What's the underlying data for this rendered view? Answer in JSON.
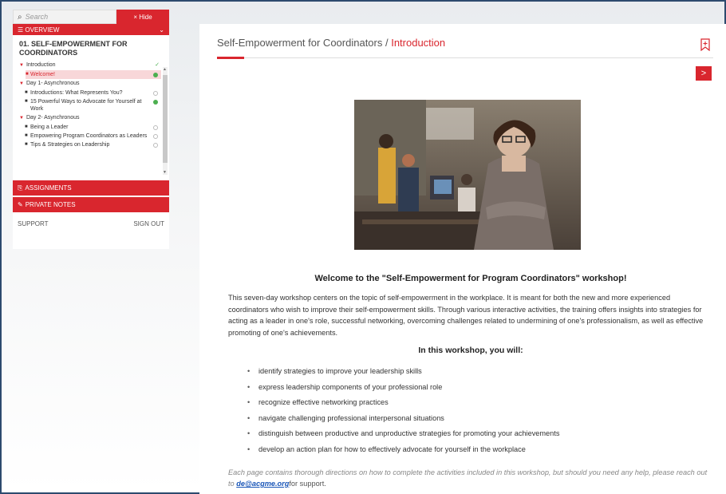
{
  "sidebar": {
    "search_placeholder": "Search",
    "hide_label": "× Hide",
    "overview_label": "☰ OVERVIEW",
    "course_title": "01. SELF-EMPOWERMENT FOR COORDINATORS",
    "items": [
      {
        "label": "Introduction",
        "type": "section",
        "status": "check"
      },
      {
        "label": "Welcome!",
        "type": "lesson",
        "status": "green",
        "active": true
      },
      {
        "label": "Day 1- Asynchronous",
        "type": "section",
        "status": ""
      },
      {
        "label": "Introductions: What Represents You?",
        "type": "lesson",
        "status": "empty"
      },
      {
        "label": "15 Powerful Ways to Advocate for Yourself at Work",
        "type": "lesson",
        "status": "green"
      },
      {
        "label": "Day 2- Asynchronous",
        "type": "section",
        "status": ""
      },
      {
        "label": "Being a Leader",
        "type": "lesson",
        "status": "empty"
      },
      {
        "label": "Empowering Program Coordinators as Leaders",
        "type": "lesson",
        "status": "empty"
      },
      {
        "label": "Tips & Strategies on Leadership",
        "type": "lesson",
        "status": "empty"
      }
    ],
    "assignments_label": "ASSIGNMENTS",
    "private_notes_label": "PRIVATE NOTES",
    "support_label": "SUPPORT",
    "signout_label": "SIGN OUT"
  },
  "main": {
    "breadcrumb_parent": "Self-Empowerment for Coordinators",
    "breadcrumb_sep": " / ",
    "breadcrumb_current": "Introduction",
    "next_label": ">",
    "welcome_heading": "Welcome to the \"Self-Empowerment for Program Coordinators\" workshop!",
    "intro_paragraph": "This seven-day workshop centers on the topic of self-empowerment in the workplace. It is meant for both the new and more experienced coordinators who wish to improve their self-empowerment skills. Through various interactive activities, the training offers insights into strategies for acting as a leader in one's role, successful networking, overcoming challenges related to undermining of one's professionalism, as well as effective promoting of one's achievements.",
    "subheading": "In this workshop, you will:",
    "bullets": [
      "identify strategies to improve your leadership skills",
      "express leadership components of your professional role",
      "recognize effective networking practices",
      "navigate challenging professional interpersonal situations",
      "distinguish between productive and unproductive strategies for promoting your achievements",
      "develop an action plan for how to effectively advocate for yourself in the workplace"
    ],
    "footer_text": "Each page contains thorough directions on how to complete the activities included in this workshop, but should you need any help, please reach out to ",
    "footer_email": "de@acgme.org",
    "footer_tail": "for support."
  },
  "colors": {
    "accent": "#d9262e",
    "link": "#1a56b8",
    "complete": "#4caf50"
  },
  "icons": [
    "search-icon",
    "close-icon",
    "menu-icon",
    "chevron-down-icon",
    "check-icon",
    "assignments-icon",
    "notes-icon",
    "bookmark-icon",
    "chevron-right-icon"
  ]
}
